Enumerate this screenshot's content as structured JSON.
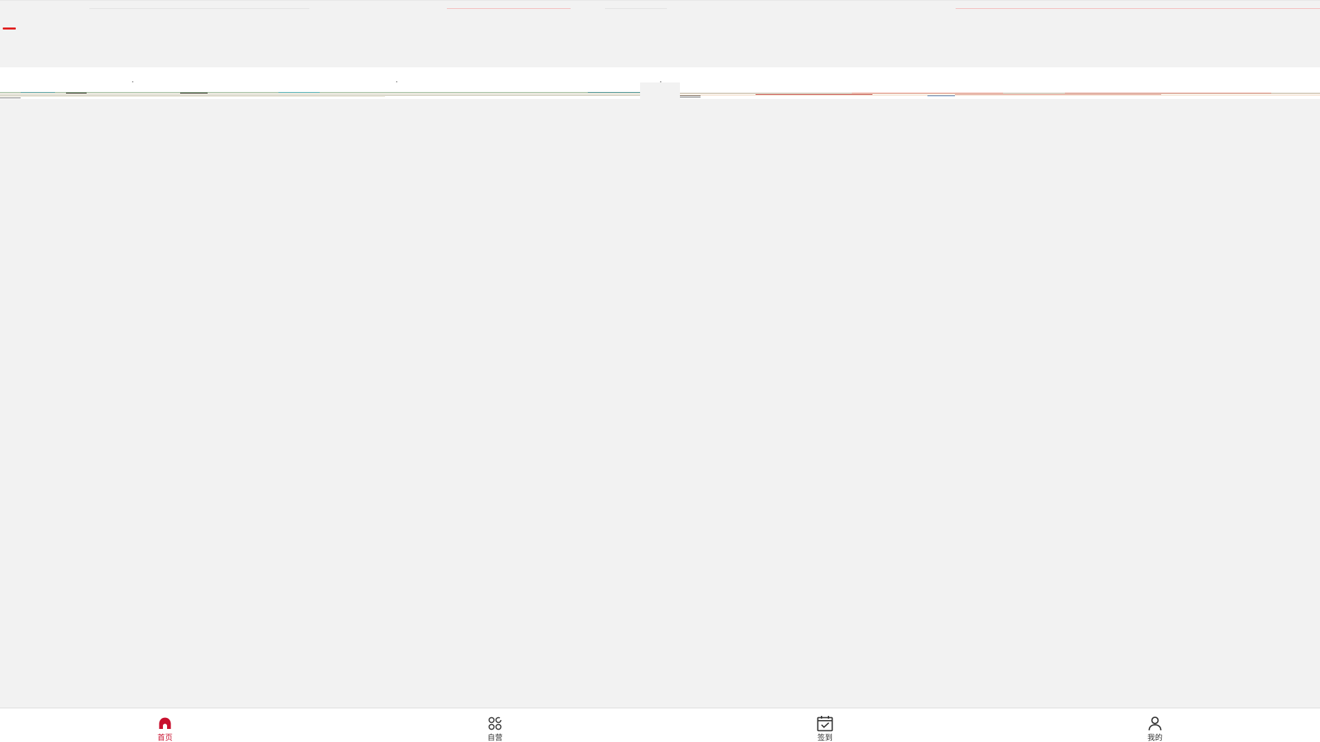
{
  "theme": {
    "accent": "#c8102e",
    "tab_text": "#333333",
    "background": "#f2f2f2"
  },
  "category_tabs": [
    "",
    "",
    "",
    "",
    "",
    "",
    "",
    "",
    "",
    "",
    "",
    "",
    "",
    "",
    ""
  ],
  "tabbar": {
    "items": [
      {
        "label": "首页",
        "icon": "home-icon",
        "active": true
      },
      {
        "label": "自营",
        "icon": "grid-icon",
        "active": false
      },
      {
        "label": "签到",
        "icon": "calendar-check-icon",
        "active": false
      },
      {
        "label": "我的",
        "icon": "user-icon",
        "active": false
      }
    ]
  }
}
